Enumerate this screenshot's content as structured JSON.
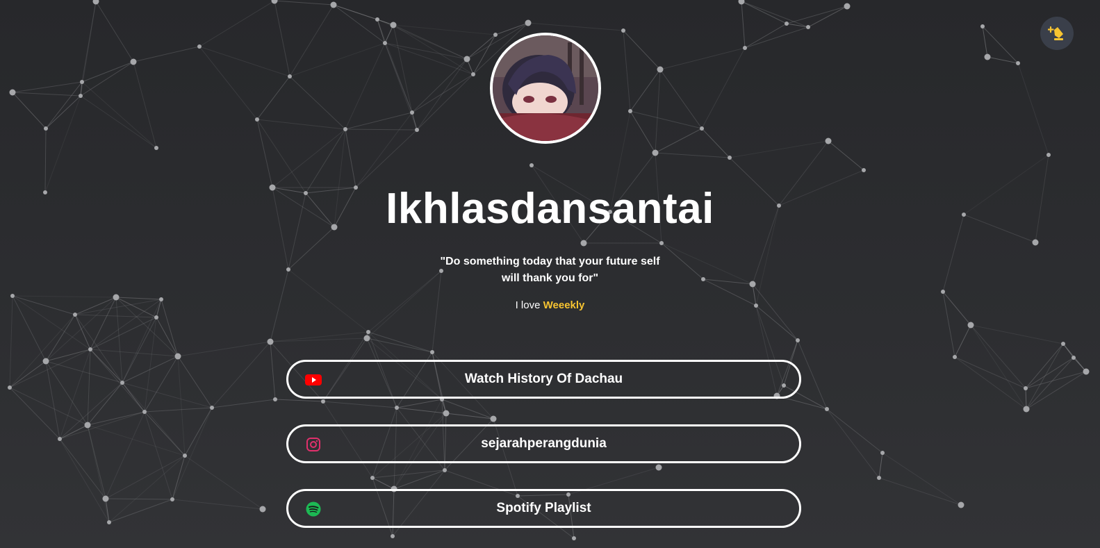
{
  "profile": {
    "name": "Ikhlasdansantai",
    "quote_line1": "\"Do something today that your future self",
    "quote_line2": "will thank you for\"",
    "love_prefix": "I love",
    "love_accent": "Weeekly"
  },
  "theme_toggle": {
    "icon": "theme-toggle-icon"
  },
  "links": [
    {
      "label": "Watch History Of Dachau",
      "icon": "youtube-icon"
    },
    {
      "label": "sejarahperangdunia",
      "icon": "instagram-icon"
    },
    {
      "label": "Spotify Playlist",
      "icon": "spotify-icon"
    }
  ],
  "colors": {
    "background": "#2a2b2e",
    "accent": "#f7c431",
    "youtube": "#ff0000",
    "instagram": "#e1306c",
    "spotify": "#1db954"
  }
}
